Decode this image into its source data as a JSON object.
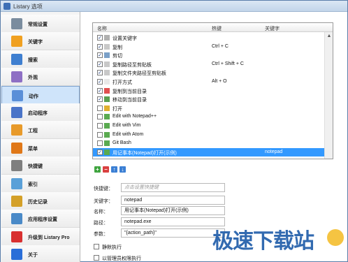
{
  "window": {
    "title": "Listary 选项"
  },
  "sidebar": {
    "items": [
      {
        "label": "常规设置",
        "icon": "gear-icon",
        "color": "#7a8c9e"
      },
      {
        "label": "关键字",
        "icon": "abc-icon",
        "color": "#f0a020"
      },
      {
        "label": "搜索",
        "icon": "search-icon",
        "color": "#3f7fd0"
      },
      {
        "label": "外观",
        "icon": "brush-icon",
        "color": "#8e6fc4"
      },
      {
        "label": "动作",
        "icon": "action-icon",
        "color": "#5a8fd8"
      },
      {
        "label": "启动程序",
        "icon": "launcher-icon",
        "color": "#4a74c8"
      },
      {
        "label": "工程",
        "icon": "project-icon",
        "color": "#e89a2a"
      },
      {
        "label": "菜单",
        "icon": "menu-icon",
        "color": "#e07818"
      },
      {
        "label": "快捷键",
        "icon": "keyboard-icon",
        "color": "#7f7f7f"
      },
      {
        "label": "索引",
        "icon": "index-icon",
        "color": "#5aa0d8"
      },
      {
        "label": "历史记录",
        "icon": "history-icon",
        "color": "#d4a028"
      },
      {
        "label": "应用程序设置",
        "icon": "app-settings-icon",
        "color": "#4a8ac8"
      },
      {
        "label": "升级到 Listary Pro",
        "icon": "upgrade-icon",
        "color": "#d83030"
      },
      {
        "label": "关于",
        "icon": "about-icon",
        "color": "#2a6ed8"
      }
    ],
    "active_index": 4
  },
  "list": {
    "columns": {
      "name": "名称",
      "hotkey": "热键",
      "keyword": "关键字"
    },
    "rows": [
      {
        "name": "设置关键字",
        "hotkey": "",
        "keyword": "",
        "checked": true,
        "icon_color": "#b0b0b0"
      },
      {
        "name": "复制",
        "hotkey": "Ctrl + C",
        "keyword": "",
        "checked": true,
        "icon_color": "#c8c8c8"
      },
      {
        "name": "剪切",
        "hotkey": "",
        "keyword": "",
        "checked": true,
        "icon_color": "#7aa0c8"
      },
      {
        "name": "复制路径至剪贴板",
        "hotkey": "Ctrl + Shift + C",
        "keyword": "",
        "checked": true,
        "icon_color": "#c8c8c8"
      },
      {
        "name": "复制文件夹路径至剪贴板",
        "hotkey": "",
        "keyword": "",
        "checked": true,
        "icon_color": "#c8c8c8"
      },
      {
        "name": "打开方式",
        "hotkey": "Alt + O",
        "keyword": "",
        "checked": true,
        "icon_color": "#e8e8e8"
      },
      {
        "name": "复制到当前目录",
        "hotkey": "",
        "keyword": "",
        "checked": true,
        "icon_color": "#e05050"
      },
      {
        "name": "移动到当前目录",
        "hotkey": "",
        "keyword": "",
        "checked": true,
        "icon_color": "#5aa050"
      },
      {
        "name": "打开",
        "hotkey": "",
        "keyword": "",
        "checked": false,
        "icon_color": "#e0b030"
      },
      {
        "name": "Edit with Notepad++",
        "hotkey": "",
        "keyword": "",
        "checked": false,
        "icon_color": "#5aaa50"
      },
      {
        "name": "Edit with Vim",
        "hotkey": "",
        "keyword": "",
        "checked": false,
        "icon_color": "#5aaa50"
      },
      {
        "name": "Edit with Atom",
        "hotkey": "",
        "keyword": "",
        "checked": false,
        "icon_color": "#5aaa50"
      },
      {
        "name": "Git Bash",
        "hotkey": "",
        "keyword": "",
        "checked": false,
        "icon_color": "#5aaa50"
      },
      {
        "name": "用记事本(Notepad)打开(示例)",
        "hotkey": "",
        "keyword": "notepad",
        "checked": true,
        "selected": true,
        "icon_color": "#5aaa50"
      }
    ]
  },
  "toolbar": {
    "add": "+",
    "remove": "−",
    "up": "↑",
    "down": "↓"
  },
  "form": {
    "hotkey_label": "快捷键：",
    "hotkey_placeholder": "点击设置快捷键",
    "keyword_label": "关键字：",
    "keyword_value": "notepad",
    "name_label": "名称：",
    "name_value": "用记事本(Notepad)打开(示例)",
    "path_label": "路径：",
    "path_value": "notepad.exe",
    "params_label": "参数：",
    "params_value": "\"{action_path}\"",
    "silent_label": "静默执行",
    "admin_label": "以管理员权限执行"
  },
  "watermark": {
    "text": "极速下载站"
  }
}
